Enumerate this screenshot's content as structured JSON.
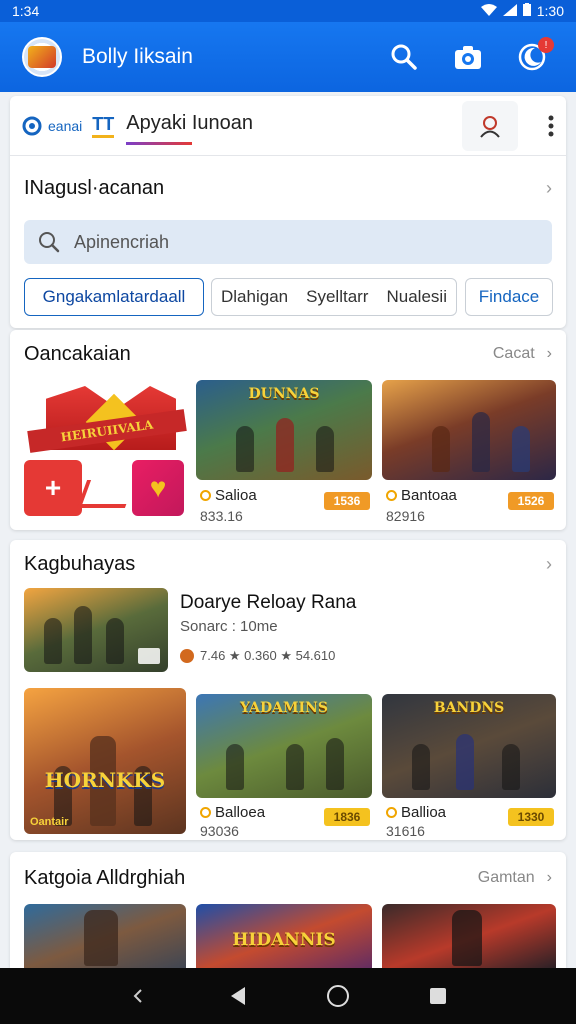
{
  "status": {
    "time": "1:34",
    "clock_right": "1:30"
  },
  "app": {
    "title": "Bolly Iiksain",
    "notification_count": "!"
  },
  "tabs": {
    "brand_label": "eanai",
    "tt_label": "TT",
    "active_label": "Apyaki Iunoan"
  },
  "explore": {
    "title": "INagusl·acanan",
    "search_placeholder": "Apinencriah",
    "chips": [
      "Gngakamlatardaall",
      "Dlahigan",
      "Syelltarr",
      "Nualesii",
      "Findace"
    ]
  },
  "section1": {
    "title": "Oancakaian",
    "see_all": "Cacat",
    "items": [
      {
        "art": "DUNNAS",
        "name": "Salioa",
        "sub": "833.16",
        "price": "1536"
      },
      {
        "art": "",
        "name": "Bantoaa",
        "sub": "82916",
        "price": "1526"
      }
    ],
    "promo_text": "HEIRUIIVALA"
  },
  "section2": {
    "title": "Kagbuhayas",
    "featured": {
      "title": "Doarye Reloay Rana",
      "subtitle": "Sonarc : 10me",
      "stats": "7.46 ★ 0.360 ★ 54.610"
    },
    "items": [
      {
        "art": "HORNKKS",
        "bottom": "Oantair",
        "name": "",
        "sub": "",
        "price": ""
      },
      {
        "art": "YADAMINS",
        "name": "Balloea",
        "sub": "93036",
        "price": "1836"
      },
      {
        "art": "BANDNS",
        "name": "Ballioa",
        "sub": "31616",
        "price": "1330"
      }
    ]
  },
  "section3": {
    "title": "Katgoia Alldrghiah",
    "see_all": "Gamtan",
    "items": [
      {
        "art": ""
      },
      {
        "art": "HIDANNIS"
      },
      {
        "art": ""
      }
    ]
  }
}
